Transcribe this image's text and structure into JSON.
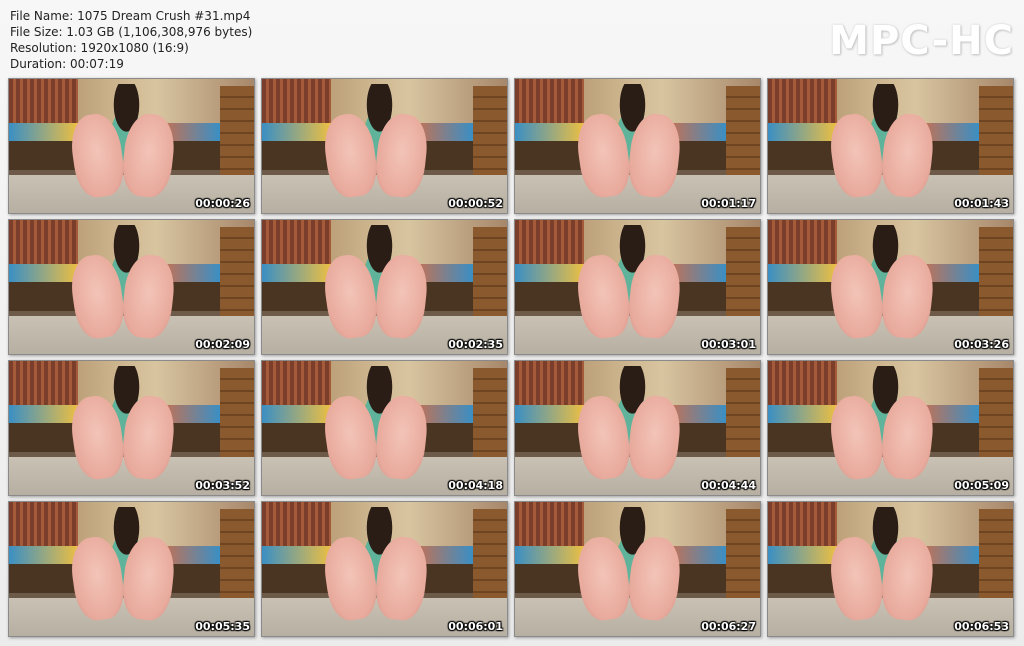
{
  "header": {
    "file_name": "File Name: 1075 Dream Crush #31.mp4",
    "file_size": "File Size: 1.03 GB (1,106,308,976 bytes)",
    "resolution": "Resolution: 1920x1080 (16:9)",
    "duration": "Duration: 00:07:19"
  },
  "logo": "MPC-HC",
  "thumbnails": [
    {
      "timestamp": "00:00:26"
    },
    {
      "timestamp": "00:00:52"
    },
    {
      "timestamp": "00:01:17"
    },
    {
      "timestamp": "00:01:43"
    },
    {
      "timestamp": "00:02:09"
    },
    {
      "timestamp": "00:02:35"
    },
    {
      "timestamp": "00:03:01"
    },
    {
      "timestamp": "00:03:26"
    },
    {
      "timestamp": "00:03:52"
    },
    {
      "timestamp": "00:04:18"
    },
    {
      "timestamp": "00:04:44"
    },
    {
      "timestamp": "00:05:09"
    },
    {
      "timestamp": "00:05:35"
    },
    {
      "timestamp": "00:06:01"
    },
    {
      "timestamp": "00:06:27"
    },
    {
      "timestamp": "00:06:53"
    }
  ]
}
